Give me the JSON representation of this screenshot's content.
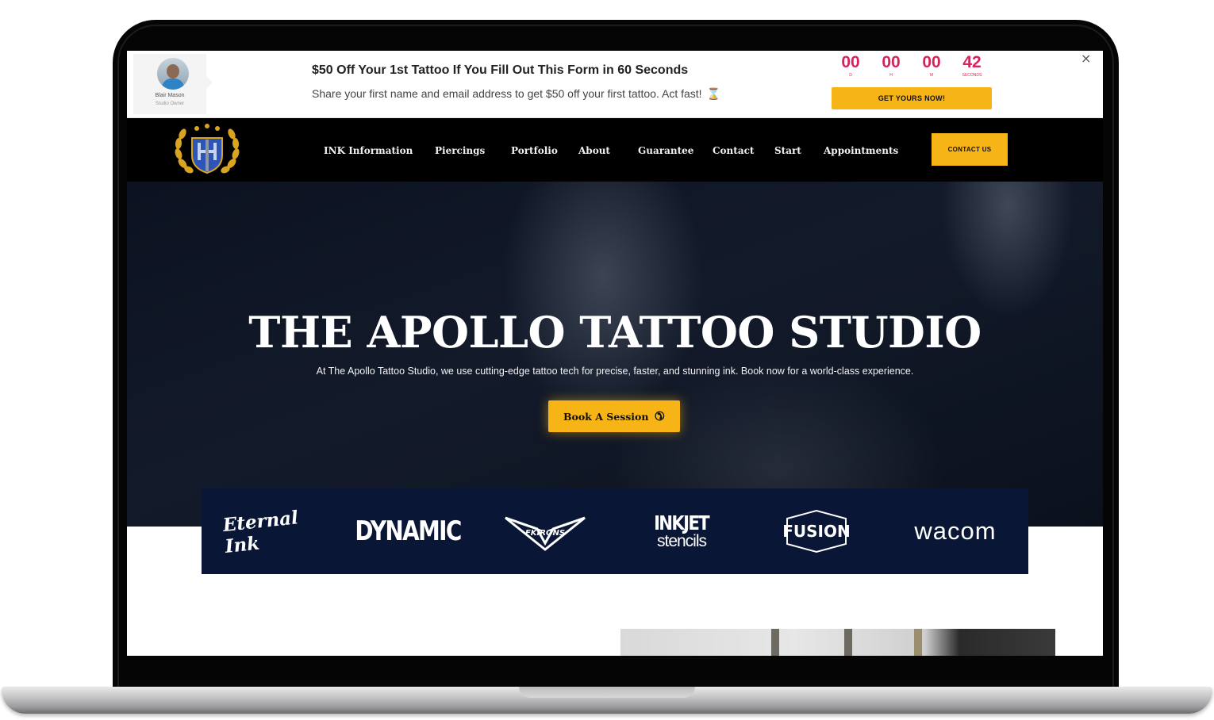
{
  "promo": {
    "owner_name": "Blair Mason",
    "owner_role": "Studio Owner",
    "title": "$50 Off Your 1st Tattoo If You Fill Out This Form in 60 Seconds",
    "subtitle": "Share your first name and email address to get $50 off your first tattoo. Act fast!",
    "countdown": [
      {
        "value": "00",
        "label": "D"
      },
      {
        "value": "00",
        "label": "H"
      },
      {
        "value": "00",
        "label": "M"
      },
      {
        "value": "42",
        "label": "SECONDS"
      }
    ],
    "cta_label": "GET YOURS NOW!",
    "close_label": "×"
  },
  "nav": {
    "items": [
      "INK Information",
      "Piercings",
      "Portfolio",
      "About",
      "Guarantee",
      "Contact",
      "Start",
      "Appointments"
    ],
    "contact_label": "CONTACT US"
  },
  "hero": {
    "title": "THE APOLLO TATTOO STUDIO",
    "subtitle": "At The Apollo Tattoo Studio, we use cutting-edge tattoo tech for precise, faster, and stunning ink. Book now for a world-class experience.",
    "cta_label": "Book A Session"
  },
  "brands": {
    "eternal": "Eternal Ink",
    "dynamic": "DYNAMIC",
    "fkirons": "FKIRONS",
    "inkjet_1": "INKJET",
    "inkjet_2": "stencils",
    "fusion": "FUSION",
    "wacom": "wacom"
  },
  "colors": {
    "accent": "#f6b416",
    "countdown": "#d6245a",
    "nav_bg": "#000000",
    "brand_strip_bg": "#0a1636"
  }
}
